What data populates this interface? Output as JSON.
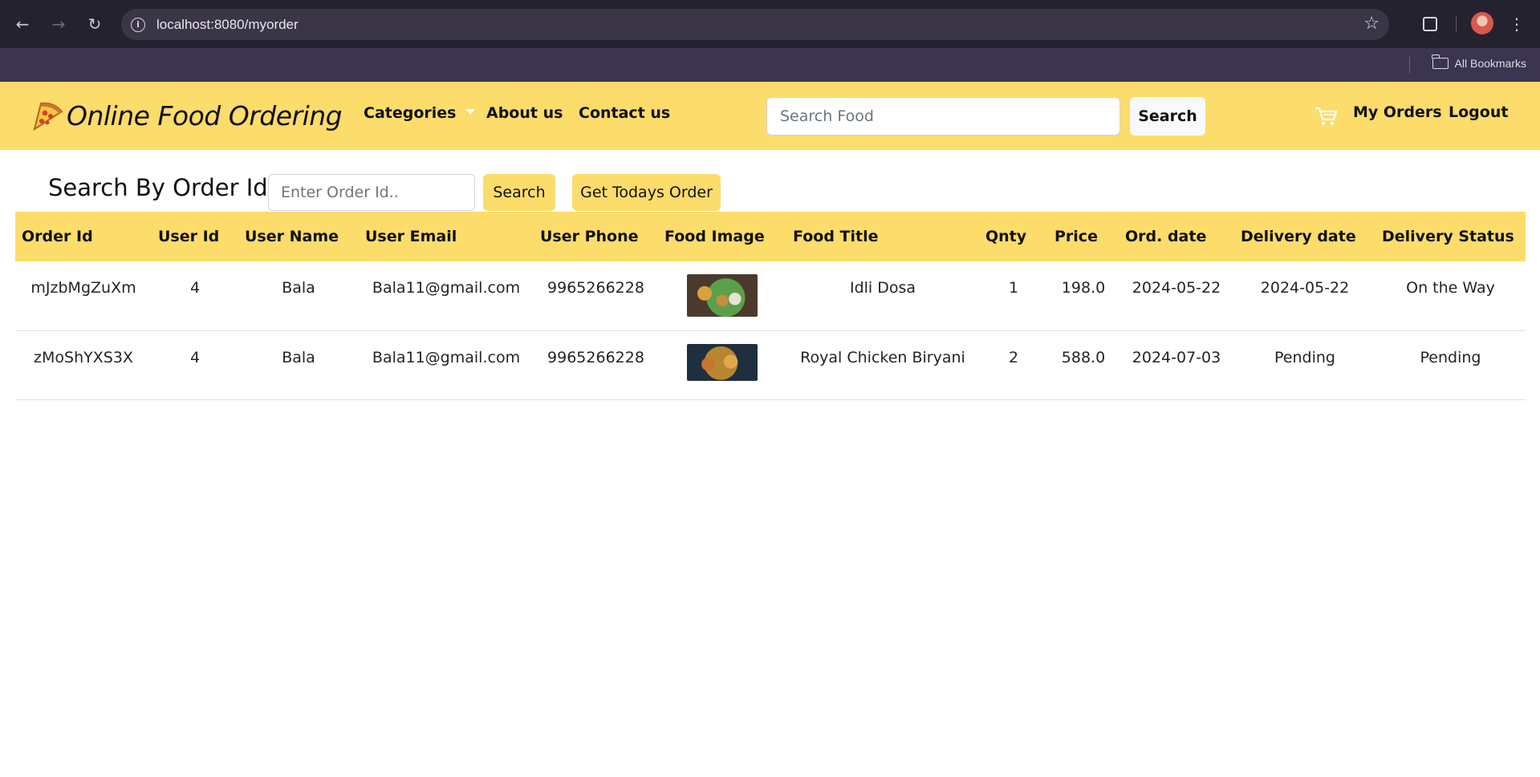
{
  "browser": {
    "url": "localhost:8080/myorder",
    "bookmarks_label": "All Bookmarks"
  },
  "navbar": {
    "brand": "Online Food Ordering",
    "links": {
      "categories": "Categories",
      "about": "About us",
      "contact": "Contact us"
    },
    "search_placeholder": "Search Food",
    "search_button": "Search",
    "my_orders": "My Orders",
    "logout": "Logout",
    "accent_color": "#fcdc6a"
  },
  "order_search": {
    "title": "Search By Order Id",
    "placeholder": "Enter Order Id..",
    "search_button": "Search",
    "todays_button": "Get Todays Order"
  },
  "table": {
    "headers": [
      "Order Id",
      "User Id",
      "User Name",
      "User Email",
      "User Phone",
      "Food Image",
      "Food Title",
      "Qnty",
      "Price",
      "Ord. date",
      "Delivery date",
      "Delivery Status"
    ],
    "rows": [
      {
        "order_id": "mJzbMgZuXm",
        "user_id": "4",
        "user_name": "Bala",
        "email": "Bala11@gmail.com",
        "phone": "9965266228",
        "image": "idli-dosa-photo",
        "title": "Idli Dosa",
        "qty": "1",
        "price": "198.0",
        "order_date": "2024-05-22",
        "delivery_date": "2024-05-22",
        "status": "On the Way"
      },
      {
        "order_id": "zMoShYXS3X",
        "user_id": "4",
        "user_name": "Bala",
        "email": "Bala11@gmail.com",
        "phone": "9965266228",
        "image": "chicken-biryani-photo",
        "title": "Royal Chicken Biryani",
        "qty": "2",
        "price": "588.0",
        "order_date": "2024-07-03",
        "delivery_date": "Pending",
        "status": "Pending"
      }
    ]
  }
}
